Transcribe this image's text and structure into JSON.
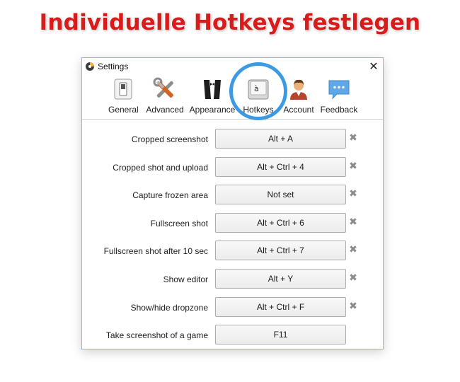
{
  "headline": "Individuelle Hotkeys festlegen",
  "window": {
    "title": "Settings",
    "close_glyph": "✕"
  },
  "tabs": [
    {
      "label": "General",
      "icon": "toggle-switch-icon"
    },
    {
      "label": "Advanced",
      "icon": "tools-icon"
    },
    {
      "label": "Appearance",
      "icon": "tuxedo-icon"
    },
    {
      "label": "Hotkeys",
      "icon": "keyboard-key-icon",
      "selected": true
    },
    {
      "label": "Account",
      "icon": "user-account-icon"
    },
    {
      "label": "Feedback",
      "icon": "speech-bubble-icon"
    }
  ],
  "hotkeys": [
    {
      "label": "Cropped screenshot",
      "value": "Alt + A",
      "clearable": true
    },
    {
      "label": "Cropped shot and upload",
      "value": "Alt + Ctrl + 4",
      "clearable": true
    },
    {
      "label": "Capture frozen area",
      "value": "Not set",
      "clearable": true
    },
    {
      "label": "Fullscreen shot",
      "value": "Alt + Ctrl + 6",
      "clearable": true
    },
    {
      "label": "Fullscreen shot after 10 sec",
      "value": "Alt + Ctrl + 7",
      "clearable": true
    },
    {
      "label": "Show editor",
      "value": "Alt + Y",
      "clearable": true
    },
    {
      "label": "Show/hide dropzone",
      "value": "Alt + Ctrl + F",
      "clearable": true
    },
    {
      "label": "Take screenshot of a game",
      "value": "F11",
      "clearable": false
    }
  ],
  "clear_glyph": "✖",
  "colors": {
    "headline": "#d81c1c",
    "highlight_ring": "#3b9ae1",
    "window_border": "#e2a94e"
  }
}
